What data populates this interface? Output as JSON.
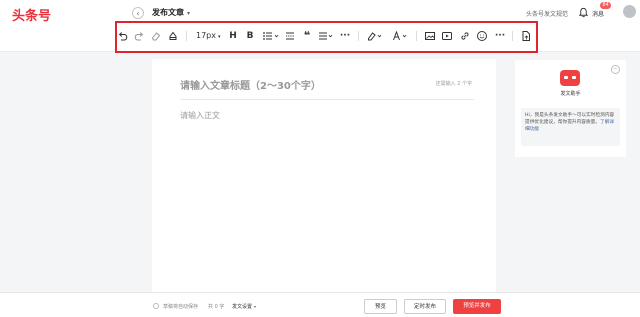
{
  "header": {
    "logo": "头条号",
    "page_title": "发布文章",
    "creator_link": "头条号发文规范",
    "notifications": {
      "label": "消息",
      "badge": "84"
    }
  },
  "toolbar": {
    "font_size": "17px",
    "heading_label": "H",
    "bold_label": "B",
    "more_label": "···"
  },
  "editor": {
    "title_placeholder": "请输入文章标题（2～30个字）",
    "title_count": "还需输入 2 个字",
    "body_placeholder": "请输入正文"
  },
  "assistant": {
    "name": "发文助手",
    "message": "Hi，我是头条发文助手～可以实时检测内容提供优化建议，帮你提升内容质量。",
    "link": "了解详细功能"
  },
  "footer": {
    "autosave": "草稿将自动保存",
    "word_count": "共 0 字",
    "settings": "发文设置",
    "preview": "预览",
    "schedule": "定时发布",
    "publish": "预览并发布"
  },
  "colors": {
    "brand": "#f04142",
    "highlight_outline": "#e0242f"
  }
}
